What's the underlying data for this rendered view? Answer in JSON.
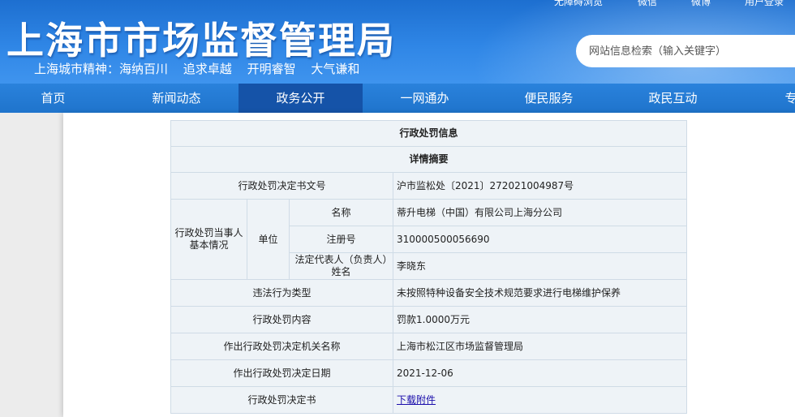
{
  "header": {
    "top_links": [
      "无障碍浏览",
      "微信",
      "微博",
      "用户登录"
    ],
    "site_title": "上海市市场监督管理局",
    "slogan_label": "上海城市精神：海纳百川",
    "slogan_items": [
      "追求卓越",
      "开明睿智",
      "大气谦和"
    ],
    "search_placeholder": "网站信息检索（输入关键字）"
  },
  "nav": {
    "items": [
      "首页",
      "新闻动态",
      "政务公开",
      "一网通办",
      "便民服务",
      "政民互动",
      "专题"
    ],
    "active_index": 2
  },
  "colors": {
    "header_blue": "#2f86e6",
    "nav_blue": "#2a82dc",
    "nav_active": "#1553a8",
    "table_bg": "#eef3f7",
    "table_border": "#cfdbe6"
  },
  "table": {
    "title": "行政处罚信息",
    "subtitle": "详情摘要",
    "decision_no_label": "行政处罚决定书文号",
    "decision_no": "沪市监松处〔2021〕272021004987号",
    "party_label": "行政处罚当事人基本情况",
    "unit_label": "单位",
    "name_label": "名称",
    "name": "蒂升电梯（中国）有限公司上海分公司",
    "reg_label": "注册号",
    "reg_no": "310000500056690",
    "rep_label": "法定代表人（负责人）姓名",
    "rep": "李晓东",
    "violation_label": "违法行为类型",
    "violation": "未按照特种设备安全技术规范要求进行电梯维护保养",
    "content_label": "行政处罚内容",
    "content": "罚款1.0000万元",
    "authority_label": "作出行政处罚决定机关名称",
    "authority": "上海市松江区市场监督管理局",
    "date_label": "作出行政处罚决定日期",
    "date": "2021-12-06",
    "doc_label": "行政处罚决定书",
    "doc_link": "下载附件"
  }
}
